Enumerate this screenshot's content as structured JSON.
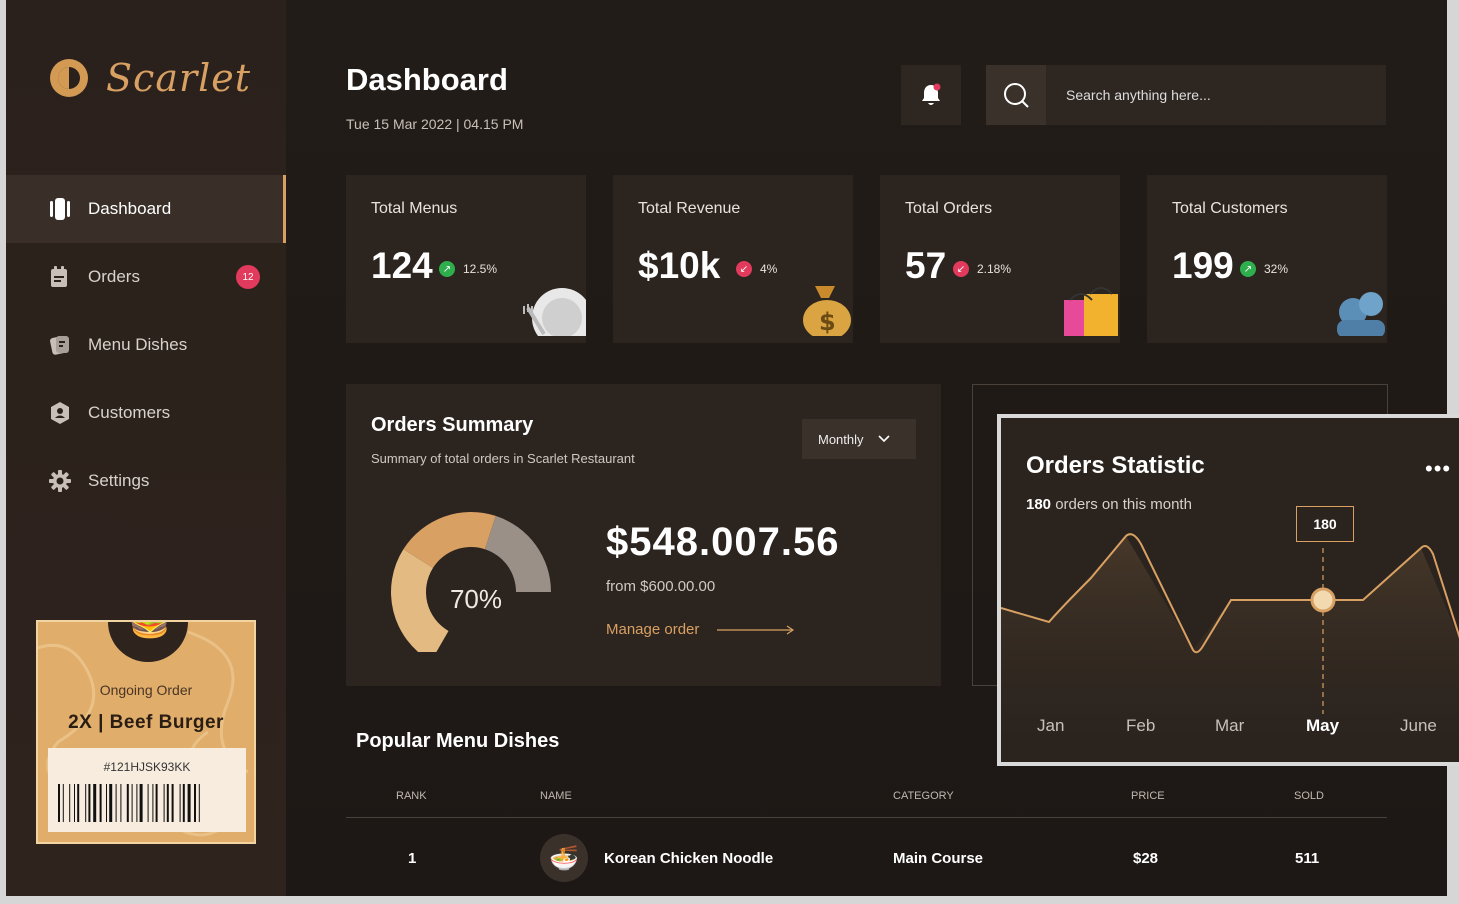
{
  "brand": {
    "name": "Scarlet"
  },
  "sidebar": {
    "items": [
      {
        "label": "Dashboard",
        "icon": "dashboard-icon",
        "active": true
      },
      {
        "label": "Orders",
        "icon": "orders-icon",
        "badge": "12"
      },
      {
        "label": "Menu Dishes",
        "icon": "menu-dishes-icon"
      },
      {
        "label": "Customers",
        "icon": "customers-icon"
      },
      {
        "label": "Settings",
        "icon": "gear-icon"
      }
    ],
    "ongoing_order": {
      "label": "Ongoing Order",
      "item": "2X  |  Beef Burger",
      "code": "#121HJSK93KK",
      "icon": "burger-icon"
    }
  },
  "header": {
    "title": "Dashboard",
    "date": "Tue 15 Mar 2022  |  04.15 PM",
    "search_placeholder": "Search anything here..."
  },
  "stats": [
    {
      "title": "Total Menus",
      "value": "124",
      "change": "12.5%",
      "trend": "up",
      "icon": "plate-icon"
    },
    {
      "title": "Total Revenue",
      "value": "$10k",
      "change": "4%",
      "trend": "down",
      "icon": "money-bag-icon"
    },
    {
      "title": "Total Orders",
      "value": "57",
      "change": "2.18%",
      "trend": "down",
      "icon": "shopping-bags-icon"
    },
    {
      "title": "Total Customers",
      "value": "199",
      "change": "32%",
      "trend": "up",
      "icon": "customers-icon"
    }
  ],
  "summary": {
    "title": "Orders Summary",
    "subtitle": "Summary of total orders in Scarlet Restaurant",
    "period": "Monthly",
    "gauge_percent": "70%",
    "gauge_fraction": 0.7,
    "amount": "$548.007.56",
    "from": "from $600.00.00",
    "manage_label": "Manage order"
  },
  "popular": {
    "title": "Popular Menu Dishes",
    "columns": [
      "RANK",
      "NAME",
      "CATEGORY",
      "PRICE",
      "SOLD"
    ],
    "rows": [
      {
        "rank": "1",
        "name": "Korean Chicken Noodle",
        "category": "Main Course",
        "price": "$28",
        "sold": "511",
        "icon": "noodle-bowl-icon"
      }
    ]
  },
  "statistic": {
    "title": "Orders Statistic",
    "count": "180",
    "count_suffix": " orders on this month",
    "tooltip": "180",
    "months": [
      "Jan",
      "Feb",
      "Mar",
      "May",
      "June"
    ],
    "selected_month": "May"
  },
  "colors": {
    "accent": "#d8a062",
    "background": "#1f1a17",
    "card": "#2c241f",
    "up": "#2fae4d",
    "down": "#e23a5c"
  }
}
